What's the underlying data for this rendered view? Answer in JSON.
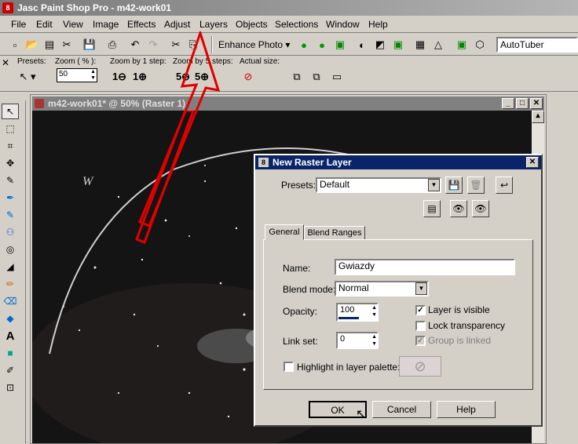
{
  "app": {
    "title": "Jasc Paint Shop Pro - m42-work01"
  },
  "menu": [
    "File",
    "Edit",
    "View",
    "Image",
    "Effects",
    "Adjust",
    "Layers",
    "Objects",
    "Selections",
    "Window",
    "Help"
  ],
  "toolbar": {
    "enhance_label": "Enhance Photo",
    "script_value": "AutoTuber"
  },
  "options": {
    "presets_label": "Presets:",
    "zoom_label": "Zoom ( % ):",
    "zoom_value": "50",
    "zoom_step_label": "Zoom by 1 step:",
    "zoom5_label": "Zoom by 5 steps:",
    "actual_label": "Actual size:"
  },
  "document": {
    "title": "m42-work01* @  50% (Raster 1)",
    "note_w": "W"
  },
  "dialog": {
    "title": "New Raster Layer",
    "presets_label": "Presets:",
    "presets_value": "Default",
    "tabs": [
      "General",
      "Blend Ranges"
    ],
    "name_label": "Name:",
    "name_value": "Gwiazdy",
    "blend_label": "Blend mode:",
    "blend_value": "Normal",
    "opacity_label": "Opacity:",
    "opacity_value": "100",
    "linkset_label": "Link set:",
    "linkset_value": "0",
    "visible_label": "Layer is visible",
    "lock_label": "Lock transparency",
    "group_label": "Group is linked",
    "highlight_label": "Highlight in layer palette:",
    "ok": "OK",
    "cancel": "Cancel",
    "help": "Help"
  }
}
